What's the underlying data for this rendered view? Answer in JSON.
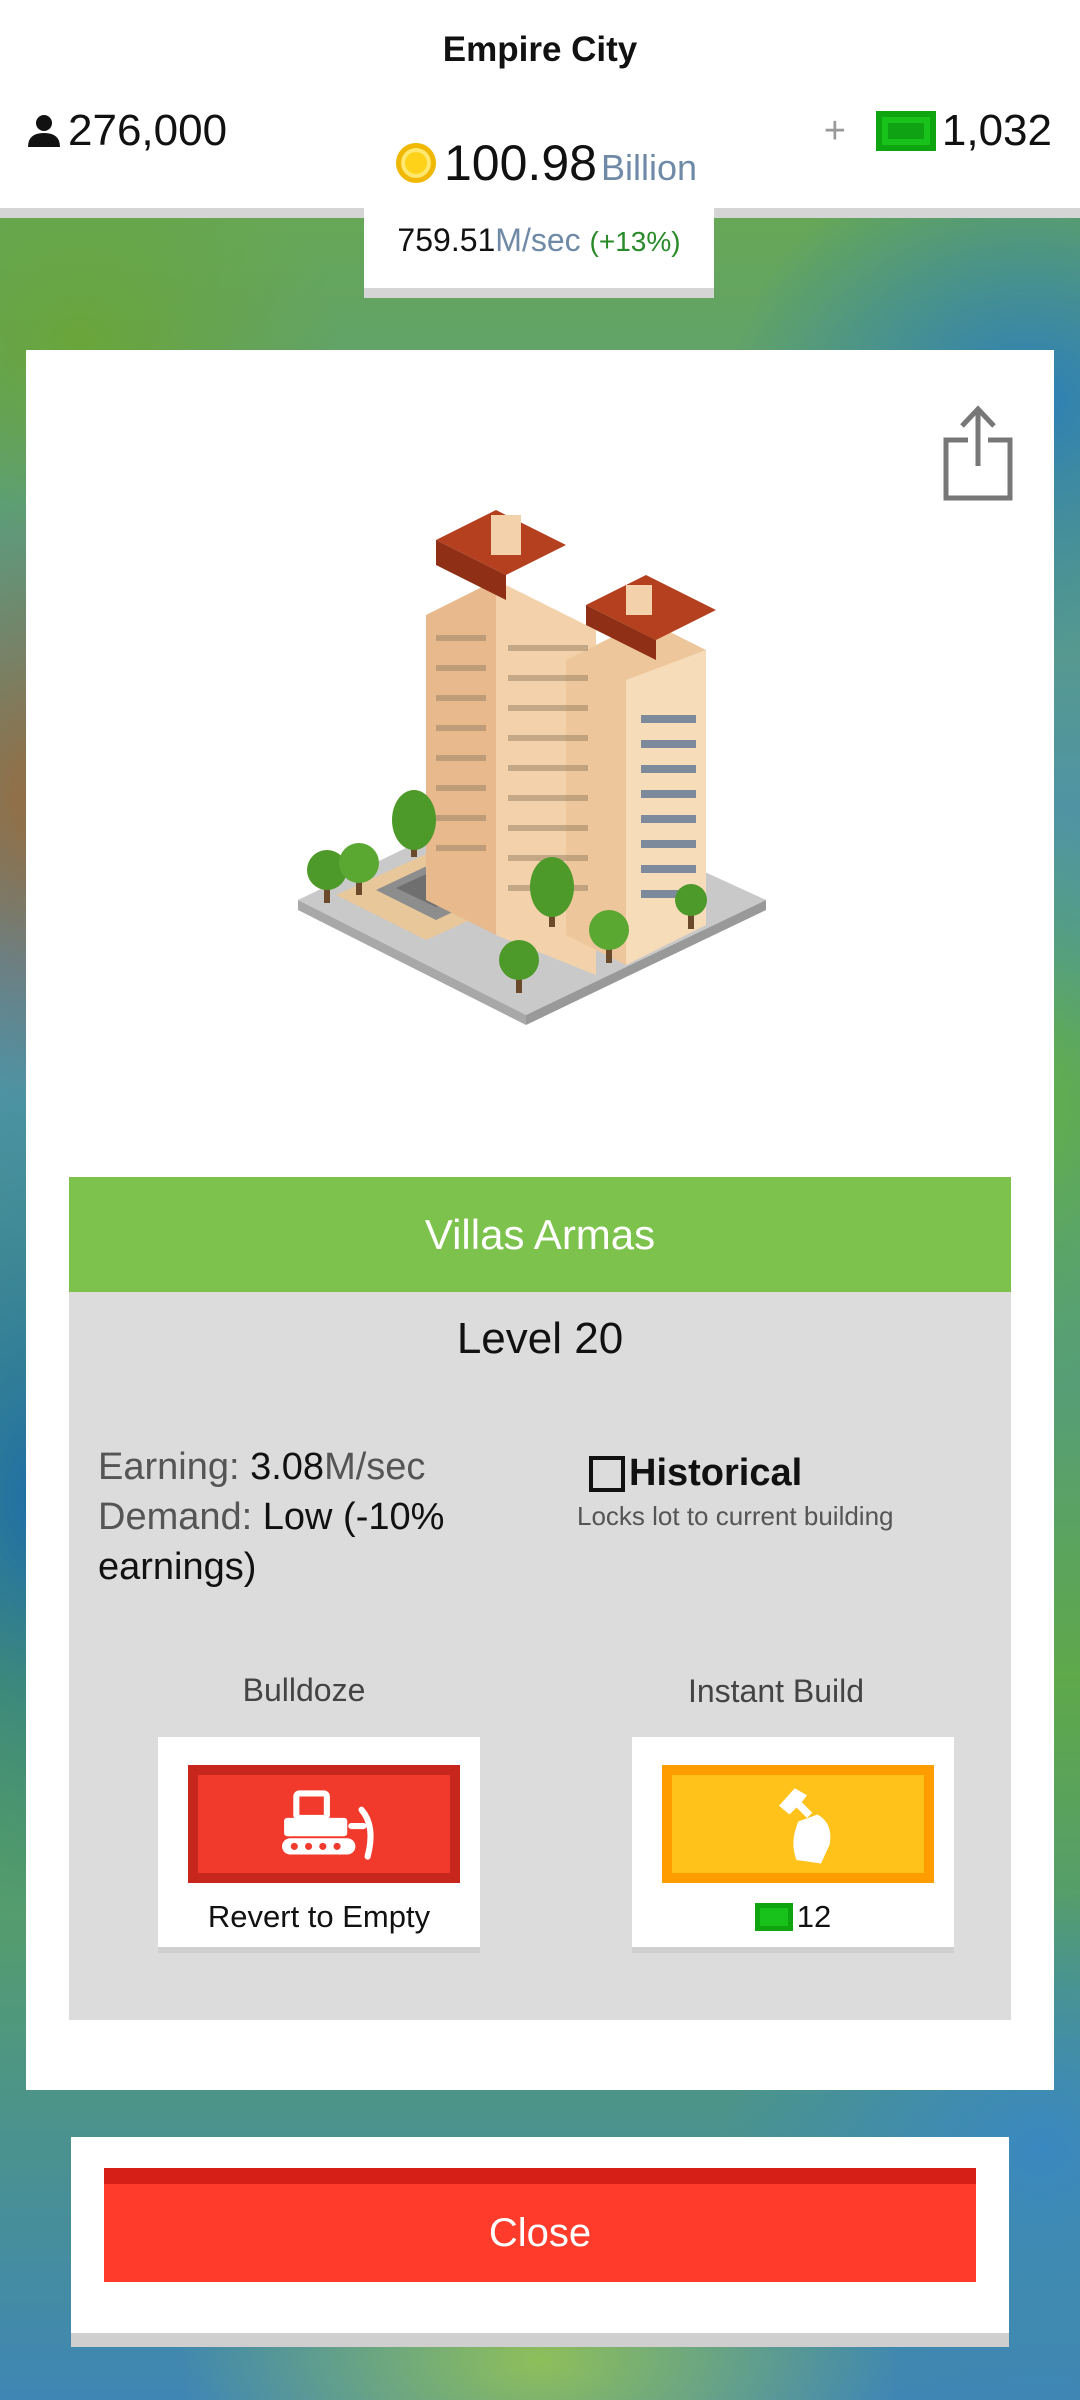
{
  "header": {
    "city_name": "Empire City",
    "population": "276,000",
    "coins_value": "100.98",
    "coins_unit": "Billion",
    "plus": "+",
    "cash": "1,032",
    "rate_value": "759.51",
    "rate_unit": "M/sec",
    "rate_change": "(+13%)"
  },
  "building": {
    "name": "Villas Armas",
    "level": "Level 20",
    "earning_label": "Earning:",
    "earning_value": "3.08",
    "earning_unit": "M/sec",
    "demand_label": "Demand:",
    "demand_value": "Low (-10% earnings)",
    "historical_label": "Historical",
    "historical_desc": "Locks lot to current building",
    "historical_checked": false
  },
  "actions": {
    "bulldoze_label": "Bulldoze",
    "bulldoze_button_text": "Revert to Empty",
    "instant_label": "Instant Build",
    "instant_cost": "12"
  },
  "close_label": "Close",
  "icons": {
    "population": "person-icon",
    "coins": "coin-icon",
    "cash": "cash-icon",
    "share": "share-icon",
    "bulldoze": "bulldozer-icon",
    "instant": "hammer-icon"
  },
  "colors": {
    "name_bar": "#7dc24c",
    "bulldoze": "#f23a2c",
    "instant": "#ffc21a",
    "close": "#ff3b2b",
    "cash": "#18c21a"
  }
}
